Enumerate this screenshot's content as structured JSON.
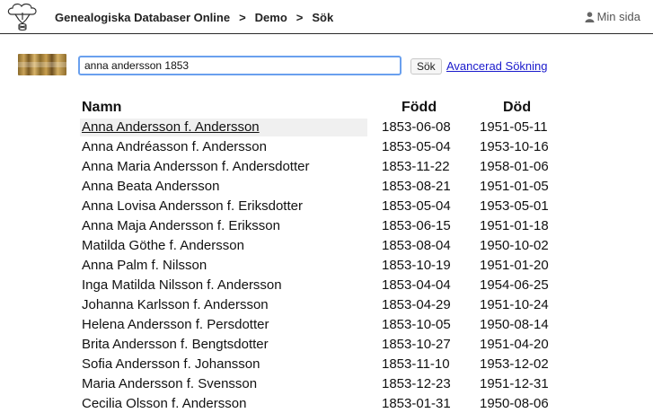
{
  "header": {
    "breadcrumb": [
      "Genealogiska Databaser Online",
      "Demo",
      "Sök"
    ],
    "separator": ">",
    "user_link": "Min sida"
  },
  "search": {
    "value": "anna andersson 1853",
    "button_label": "Sök",
    "advanced_link": "Avancerad Sökning"
  },
  "results": {
    "columns": [
      "Namn",
      "Född",
      "Död"
    ],
    "rows": [
      {
        "name": "Anna Andersson f. Andersson",
        "born": "1853-06-08",
        "died": "1951-05-11"
      },
      {
        "name": "Anna Andréasson f. Andersson",
        "born": "1853-05-04",
        "died": "1953-10-16"
      },
      {
        "name": "Anna Maria Andersson f. Andersdotter",
        "born": "1853-11-22",
        "died": "1958-01-06"
      },
      {
        "name": "Anna Beata Andersson",
        "born": "1853-08-21",
        "died": "1951-01-05"
      },
      {
        "name": "Anna Lovisa Andersson f. Eriksdotter",
        "born": "1853-05-04",
        "died": "1953-05-01"
      },
      {
        "name": "Anna Maja Andersson f. Eriksson",
        "born": "1853-06-15",
        "died": "1951-01-18"
      },
      {
        "name": "Matilda Göthe f. Andersson",
        "born": "1853-08-04",
        "died": "1950-10-02"
      },
      {
        "name": "Anna Palm f. Nilsson",
        "born": "1853-10-19",
        "died": "1951-01-20"
      },
      {
        "name": "Inga Matilda Nilsson f. Andersson",
        "born": "1853-04-04",
        "died": "1954-06-25"
      },
      {
        "name": "Johanna Karlsson f. Andersson",
        "born": "1853-04-29",
        "died": "1951-10-24"
      },
      {
        "name": "Helena Andersson f. Persdotter",
        "born": "1853-10-05",
        "died": "1950-08-14"
      },
      {
        "name": "Brita Andersson f. Bengtsdotter",
        "born": "1853-10-27",
        "died": "1951-04-20"
      },
      {
        "name": "Sofia Andersson f. Johansson",
        "born": "1853-11-10",
        "died": "1953-12-02"
      },
      {
        "name": "Maria Andersson f. Svensson",
        "born": "1853-12-23",
        "died": "1951-12-31"
      },
      {
        "name": "Cecilia Olsson f. Andersson",
        "born": "1853-01-31",
        "died": "1950-08-06"
      }
    ]
  }
}
